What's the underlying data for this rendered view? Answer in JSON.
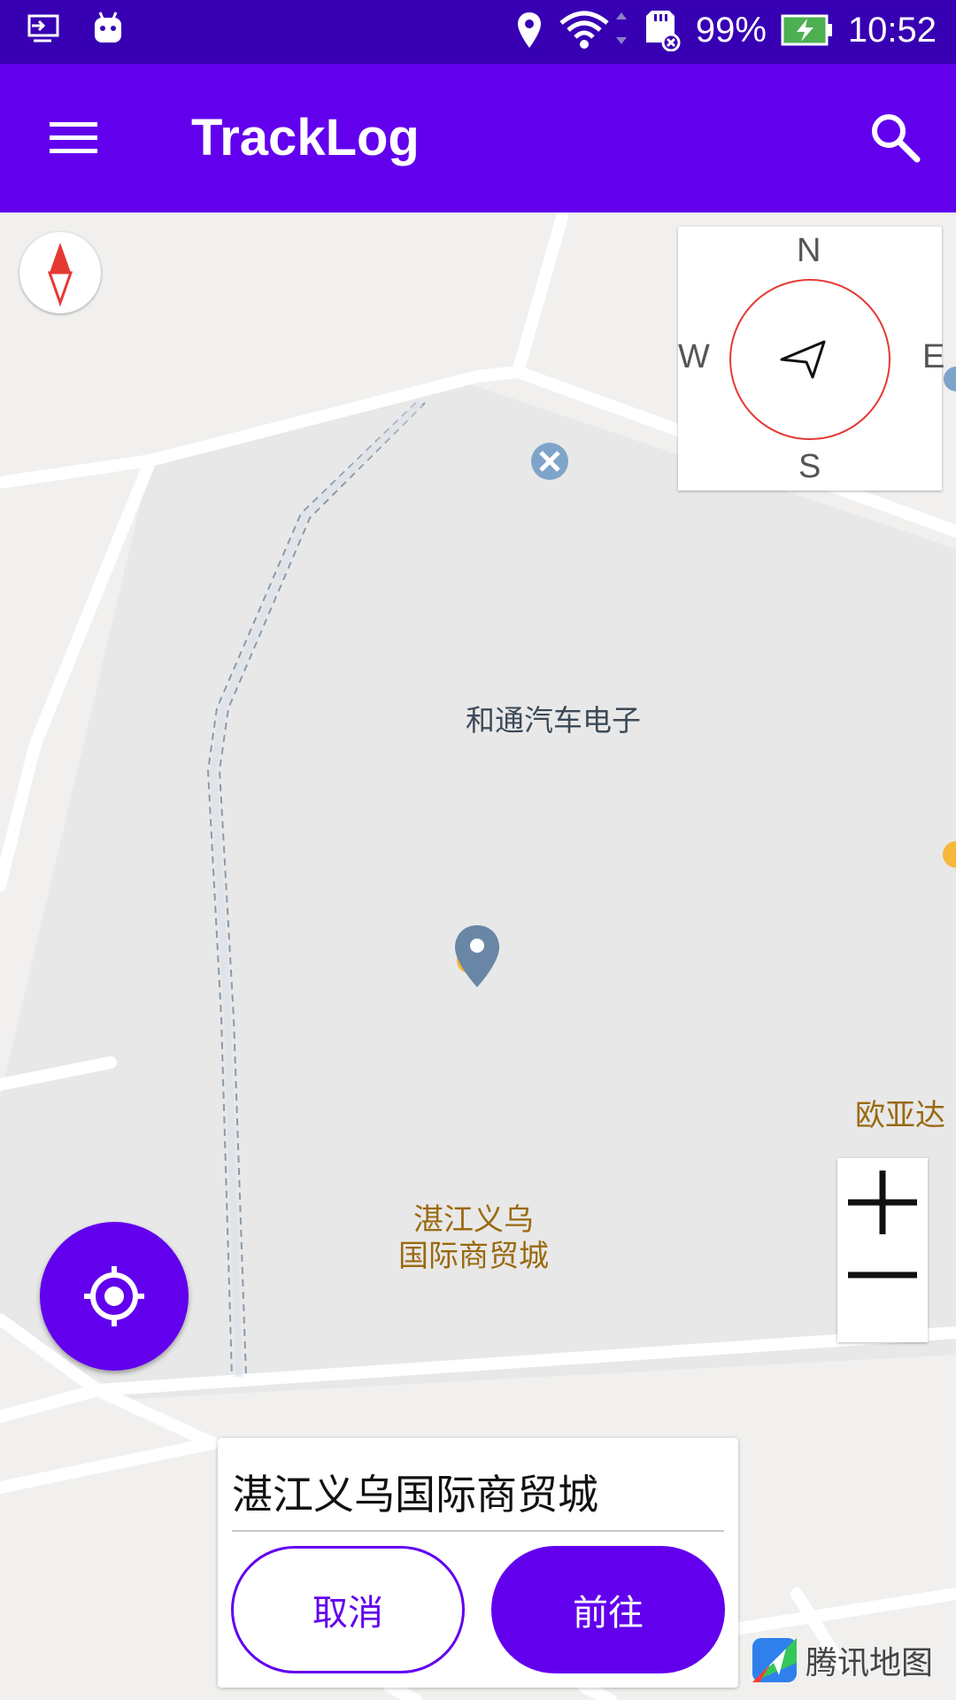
{
  "status_bar": {
    "battery_percent": "99%",
    "time": "10:52",
    "icons": [
      "screen-cast-icon",
      "android-debug-icon",
      "location-icon",
      "wifi-icon",
      "sd-card-icon",
      "battery-charging-icon"
    ]
  },
  "toolbar": {
    "title": "TrackLog",
    "menu_icon": "menu-icon",
    "search_icon": "search-icon"
  },
  "map": {
    "labels": {
      "poi_hetong": "和通汽车电子",
      "mall_line1": "湛江义乌",
      "mall_line2": "国际商贸城",
      "ouyada": "欧亚达"
    },
    "compass": {
      "n": "N",
      "e": "E",
      "s": "S",
      "w": "W"
    },
    "logo_text": "腾讯地图"
  },
  "place_card": {
    "place_name": "湛江义乌国际商贸城",
    "cancel_label": "取消",
    "go_label": "前往"
  },
  "colors": {
    "primary": "#6200ee",
    "status_bar": "#3700b3",
    "compass_ring": "#e53935"
  }
}
